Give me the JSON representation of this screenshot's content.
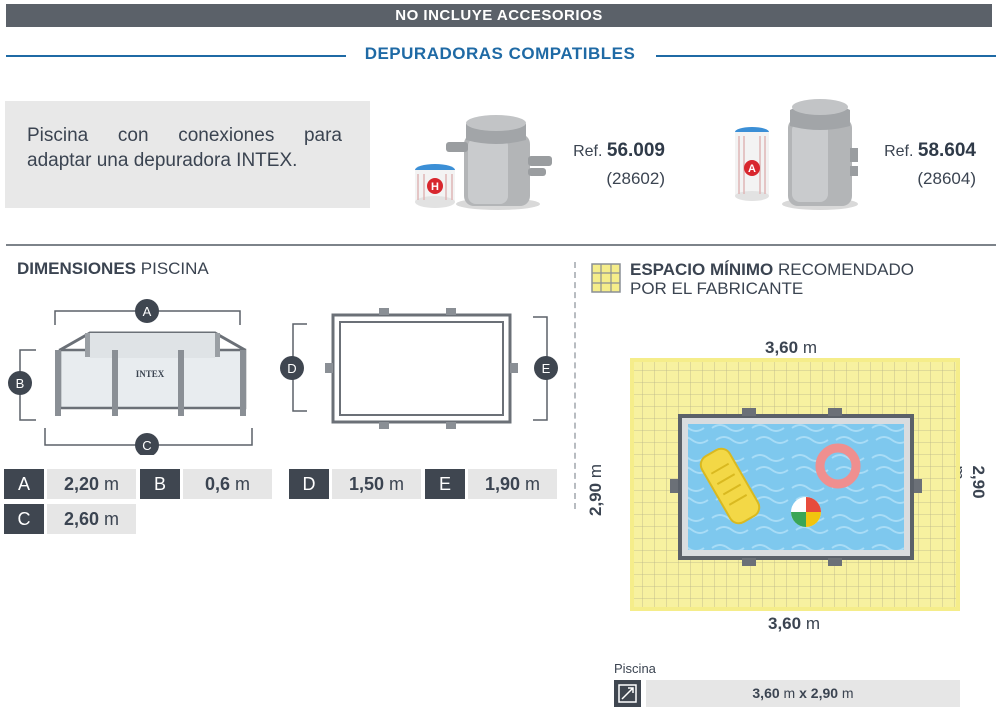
{
  "header": {
    "title": "NO INCLUYE ACCESORIOS"
  },
  "compatible": {
    "title": "DEPURADORAS COMPATIBLES",
    "description_line1": "Piscina con conexiones para",
    "description_line2": "adaptar una depuradora INTEX.",
    "pumps": [
      {
        "ref_prefix": "Ref.",
        "ref": "56.009",
        "code": "(28602)",
        "badge": "H"
      },
      {
        "ref_prefix": "Ref.",
        "ref": "58.604",
        "code": "(28604)",
        "badge": "A"
      }
    ]
  },
  "dimensions": {
    "title_bold": "DIMENSIONES",
    "title_rest": " PISCINA",
    "brand": "INTEX",
    "letters": {
      "a": "A",
      "b": "B",
      "c": "C",
      "d": "D",
      "e": "E"
    },
    "values": {
      "a": "2,20",
      "b": "0,6",
      "c": "2,60",
      "d": "1,50",
      "e": "1,90"
    },
    "unit": "m"
  },
  "space": {
    "title_bold": "ESPACIO MÍNIMO",
    "title_rest": " RECOMENDADO",
    "title_line2": "POR EL FABRICANTE",
    "top": "3,60",
    "bottom": "3,60",
    "left": "2,90",
    "right": "2,90",
    "unit": "m"
  },
  "pool_summary": {
    "label": "Piscina",
    "width": "3,60",
    "length": "2,90",
    "unit": "m",
    "sep": "x"
  },
  "colors": {
    "accent_blue": "#1f6aa5",
    "dark_gray": "#3f4650",
    "grid_yellow": "#f7f1a0",
    "water_blue": "#7ec8ee"
  }
}
